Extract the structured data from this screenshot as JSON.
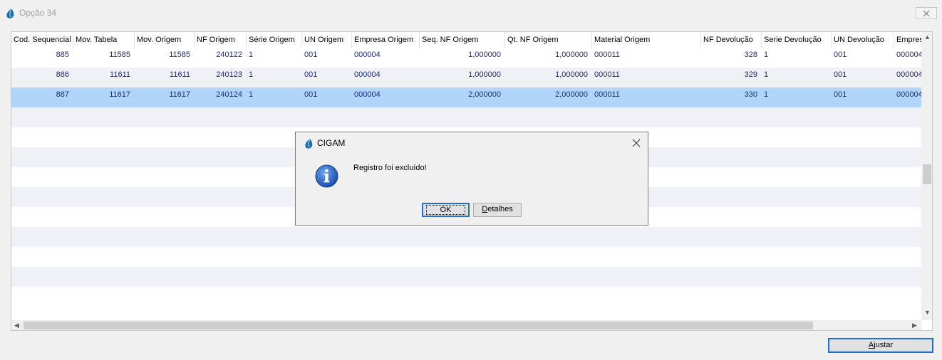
{
  "window": {
    "title": "Opção 34"
  },
  "columns": [
    {
      "label": "Cod. Sequencial",
      "align": "r"
    },
    {
      "label": "Mov. Tabela",
      "align": "r"
    },
    {
      "label": "Mov. Origem",
      "align": "r"
    },
    {
      "label": "NF Origem",
      "align": "r"
    },
    {
      "label": "Série Origem",
      "align": "l"
    },
    {
      "label": "UN Origem",
      "align": "l"
    },
    {
      "label": "Empresa Origem",
      "align": "l"
    },
    {
      "label": "Seq. NF Origem",
      "align": "r"
    },
    {
      "label": "Qt. NF Origem",
      "align": "r"
    },
    {
      "label": "Material Origem",
      "align": "l"
    },
    {
      "label": "NF Devolução",
      "align": "r"
    },
    {
      "label": "Serie Devolução",
      "align": "l"
    },
    {
      "label": "UN Devolução",
      "align": "l"
    },
    {
      "label": "Empresa",
      "align": "l"
    }
  ],
  "rows": [
    [
      "885",
      "11585",
      "11585",
      "240122",
      "1",
      "001",
      "000004",
      "1,000000",
      "1,000000",
      "000011",
      "328",
      "1",
      "001",
      "000004"
    ],
    [
      "886",
      "11611",
      "11611",
      "240123",
      "1",
      "001",
      "000004",
      "1,000000",
      "1,000000",
      "000011",
      "329",
      "1",
      "001",
      "000004"
    ],
    [
      "887",
      "11617",
      "11617",
      "240124",
      "1",
      "001",
      "000004",
      "2,000000",
      "2,000000",
      "000011",
      "330",
      "1",
      "001",
      "000004"
    ]
  ],
  "selected_row": 2,
  "empty_rows": 10,
  "buttons": {
    "ajustar_pre": "",
    "ajustar_u": "A",
    "ajustar_post": "justar"
  },
  "dialog": {
    "title": "CIGAM",
    "message": "Registro foi excluído!",
    "ok_label": "OK",
    "details_u": "D",
    "details_post": "etalhes"
  },
  "colors": {
    "selected_row": "#b1d5f9",
    "alt_row": "#f0f1f7",
    "cell_text": "#1e2a8c",
    "accent": "#2a6bd1"
  }
}
